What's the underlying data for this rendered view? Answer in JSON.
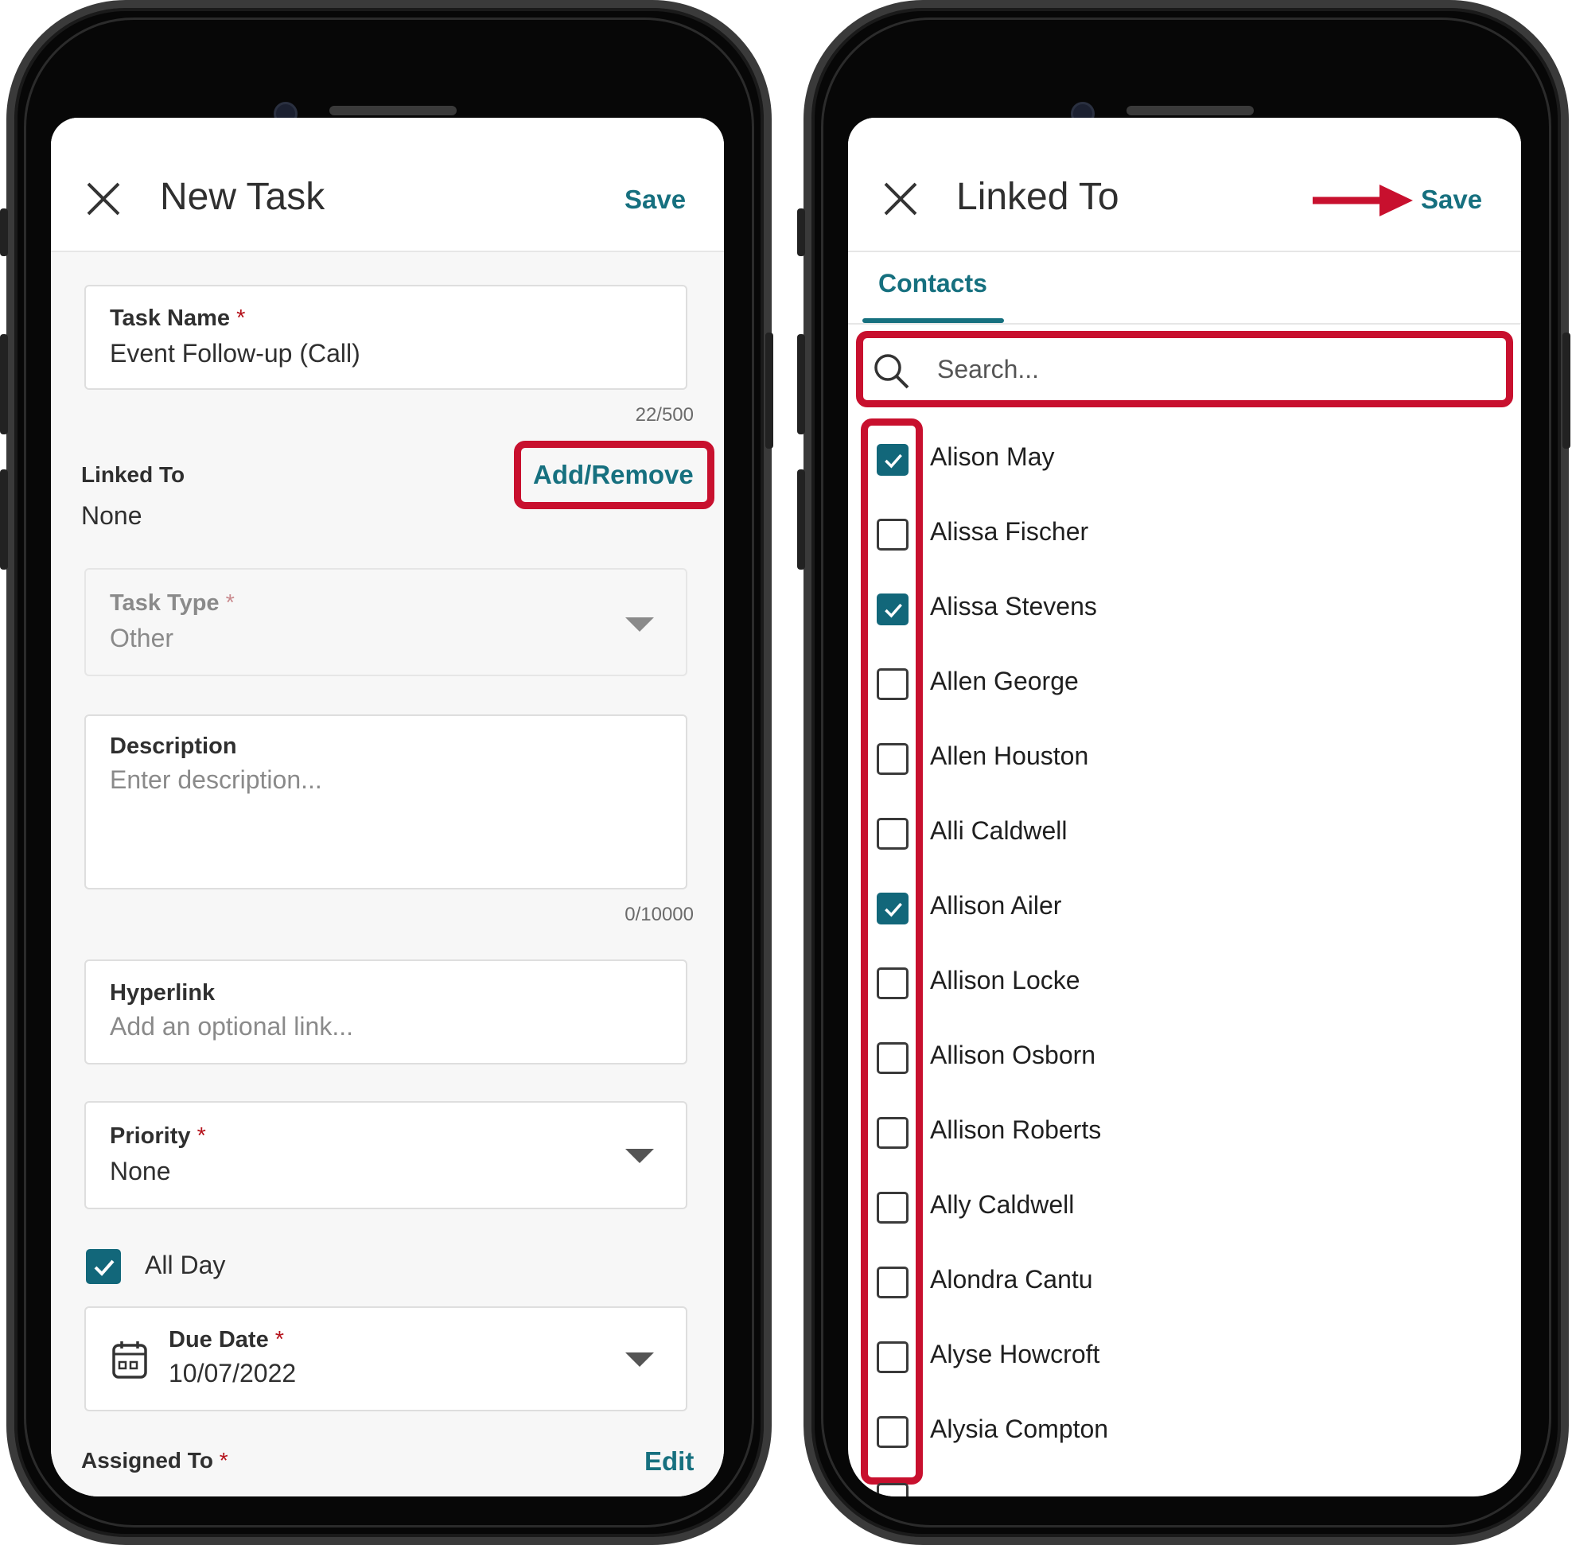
{
  "left_screen": {
    "header": {
      "title": "New Task",
      "save_label": "Save",
      "close_icon": "close-icon"
    },
    "task_name": {
      "label": "Task Name",
      "required_mark": "*",
      "value": "Event Follow-up (Call)",
      "counter": "22/500"
    },
    "linked_to": {
      "label": "Linked To",
      "value": "None",
      "action_label": "Add/Remove"
    },
    "task_type": {
      "label": "Task Type",
      "required_mark": "*",
      "value": "Other",
      "icon": "chevron-down-icon"
    },
    "description": {
      "label": "Description",
      "placeholder": "Enter description...",
      "counter": "0/10000"
    },
    "hyperlink": {
      "label": "Hyperlink",
      "placeholder": "Add an optional link..."
    },
    "priority": {
      "label": "Priority",
      "required_mark": "*",
      "value": "None",
      "icon": "chevron-down-icon"
    },
    "all_day": {
      "label": "All Day",
      "checked": true
    },
    "due_date": {
      "label": "Due Date",
      "required_mark": "*",
      "value": "10/07/2022",
      "icon": "calendar-icon"
    },
    "assigned_to": {
      "label": "Assigned To",
      "required_mark": "*",
      "action_label": "Edit"
    }
  },
  "right_screen": {
    "header": {
      "title": "Linked To",
      "save_label": "Save",
      "close_icon": "close-icon",
      "annotation_icon": "arrow-right-icon"
    },
    "tabs": [
      {
        "label": "Contacts",
        "active": true
      }
    ],
    "search": {
      "placeholder": "Search...",
      "icon": "search-icon"
    },
    "contacts": [
      {
        "name": "Alison May",
        "checked": true
      },
      {
        "name": "Alissa Fischer",
        "checked": false
      },
      {
        "name": "Alissa Stevens",
        "checked": true
      },
      {
        "name": "Allen George",
        "checked": false
      },
      {
        "name": "Allen Houston",
        "checked": false
      },
      {
        "name": "Alli Caldwell",
        "checked": false
      },
      {
        "name": "Allison Ailer",
        "checked": true
      },
      {
        "name": "Allison Locke",
        "checked": false
      },
      {
        "name": "Allison Osborn",
        "checked": false
      },
      {
        "name": "Allison Roberts",
        "checked": false
      },
      {
        "name": "Ally Caldwell",
        "checked": false
      },
      {
        "name": "Alondra Cantu",
        "checked": false
      },
      {
        "name": "Alyse Howcroft",
        "checked": false
      },
      {
        "name": "Alysia Compton",
        "checked": false
      }
    ]
  },
  "colors": {
    "accent": "#16707f",
    "checkbox_fill": "#12677a",
    "annotation_red": "#c8102e",
    "required": "#b5121b"
  }
}
